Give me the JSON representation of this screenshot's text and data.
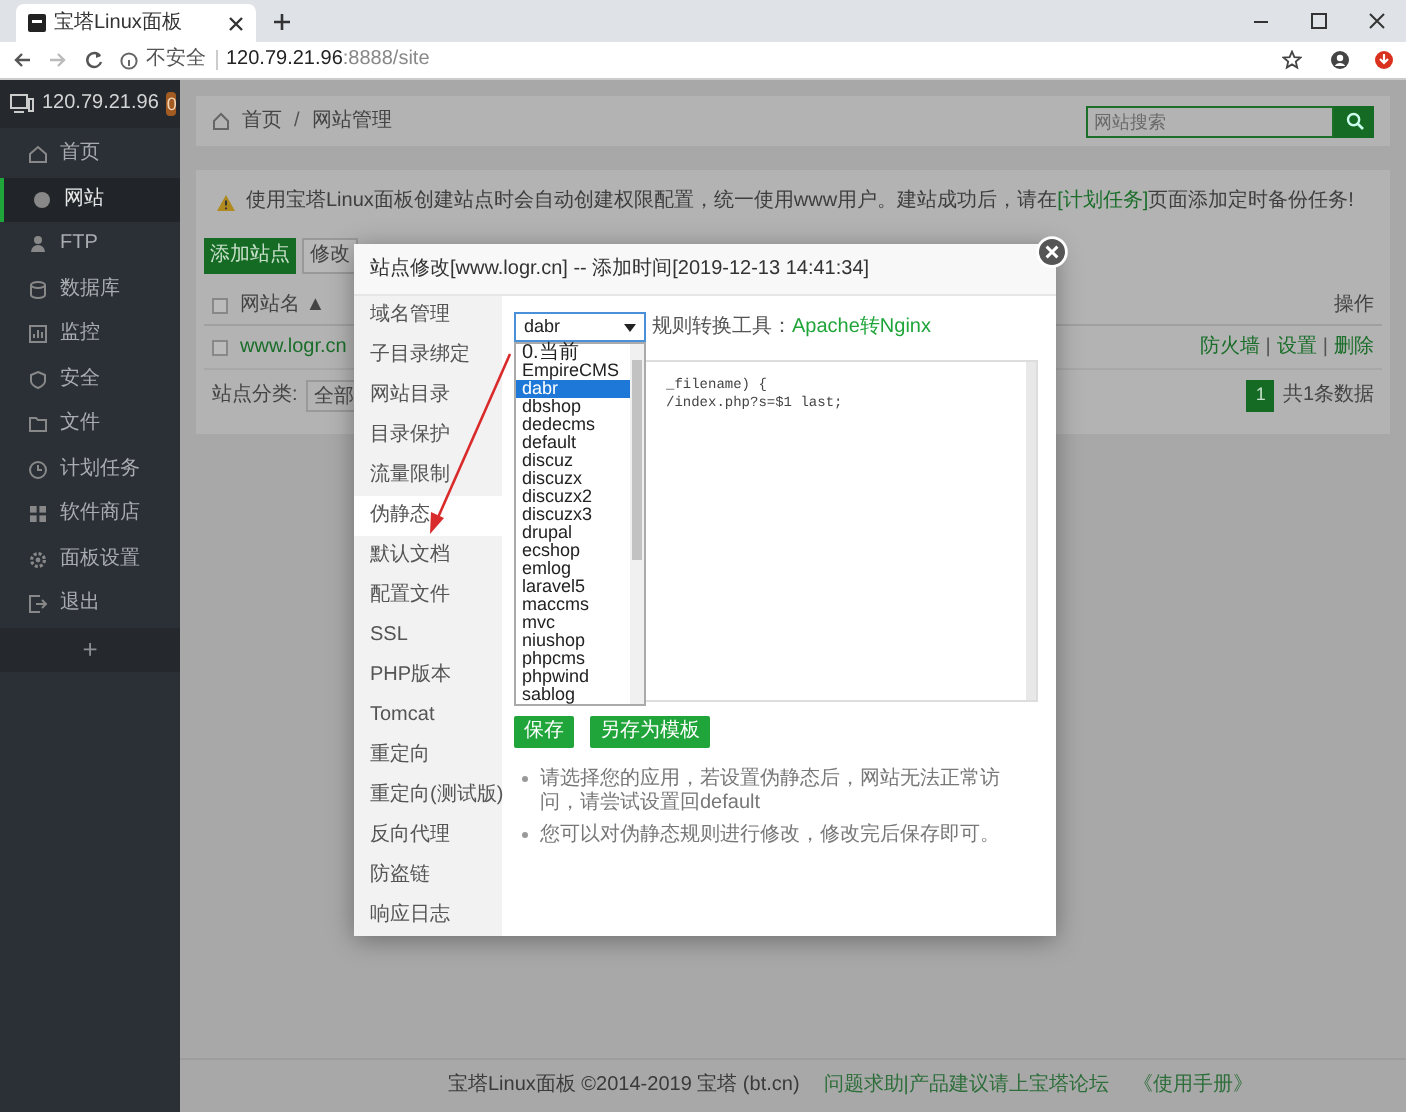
{
  "browser": {
    "tab_title": "宝塔Linux面板",
    "security": "不安全",
    "host": "120.79.21.96",
    "path": ":8888/site"
  },
  "sidebar": {
    "server": "120.79.21.96",
    "badge": "0",
    "add": "+",
    "items": [
      {
        "label": "首页",
        "selected": false
      },
      {
        "label": "网站",
        "selected": true
      },
      {
        "label": "FTP",
        "selected": false
      },
      {
        "label": "数据库",
        "selected": false
      },
      {
        "label": "监控",
        "selected": false
      },
      {
        "label": "安全",
        "selected": false
      },
      {
        "label": "文件",
        "selected": false
      },
      {
        "label": "计划任务",
        "selected": false
      },
      {
        "label": "软件商店",
        "selected": false
      },
      {
        "label": "面板设置",
        "selected": false
      },
      {
        "label": "退出",
        "selected": false
      }
    ]
  },
  "breadcrumb": {
    "home": "首页",
    "separator": "/",
    "current": "网站管理"
  },
  "search": {
    "placeholder": "网站搜索"
  },
  "notice": {
    "before": "使用宝塔Linux面板创建站点时会自动创建权限配置，统一使用www用户。建站成功后，请在",
    "link": "[计划任务]",
    "after": "页面添加定时备份任务!"
  },
  "toolbar": [
    "添加站点",
    "修改"
  ],
  "table": {
    "select_all": {
      "checked": false
    },
    "columns": [
      {
        "label": "网站名",
        "sort": "▲"
      },
      {
        "label": "操作"
      }
    ],
    "rows": [
      {
        "checked": false,
        "name": "www.logr.cn",
        "actions": [
          "防火墙",
          "设置",
          "删除"
        ],
        "separator": "|"
      }
    ]
  },
  "category": {
    "label": "站点分类:",
    "value": "全部"
  },
  "pagination": {
    "page": "1",
    "total": "共1条数据"
  },
  "modal": {
    "title": "站点修改[www.logr.cn] -- 添加时间[2019-12-13 14:41:34]",
    "menu": [
      {
        "label": "域名管理",
        "selected": false
      },
      {
        "label": "子目录绑定",
        "selected": false
      },
      {
        "label": "网站目录",
        "selected": false
      },
      {
        "label": "目录保护",
        "selected": false
      },
      {
        "label": "流量限制",
        "selected": false
      },
      {
        "label": "伪静态",
        "selected": true
      },
      {
        "label": "默认文档",
        "selected": false
      },
      {
        "label": "配置文件",
        "selected": false
      },
      {
        "label": "SSL",
        "selected": false
      },
      {
        "label": "PHP版本",
        "selected": false
      },
      {
        "label": "Tomcat",
        "selected": false
      },
      {
        "label": "重定向",
        "selected": false
      },
      {
        "label": "重定向(测试版)",
        "selected": false
      },
      {
        "label": "反向代理",
        "selected": false
      },
      {
        "label": "防盗链",
        "selected": false
      },
      {
        "label": "响应日志",
        "selected": false
      }
    ],
    "select_value": "dabr",
    "tool_label": "规则转换工具：",
    "tool_link": "Apache转Nginx",
    "options": [
      {
        "label": "0.当前",
        "selected": false
      },
      {
        "label": "EmpireCMS",
        "selected": false
      },
      {
        "label": "dabr",
        "selected": true
      },
      {
        "label": "dbshop",
        "selected": false
      },
      {
        "label": "dedecms",
        "selected": false
      },
      {
        "label": "default",
        "selected": false
      },
      {
        "label": "discuz",
        "selected": false
      },
      {
        "label": "discuzx",
        "selected": false
      },
      {
        "label": "discuzx2",
        "selected": false
      },
      {
        "label": "discuzx3",
        "selected": false
      },
      {
        "label": "drupal",
        "selected": false
      },
      {
        "label": "ecshop",
        "selected": false
      },
      {
        "label": "emlog",
        "selected": false
      },
      {
        "label": "laravel5",
        "selected": false
      },
      {
        "label": "maccms",
        "selected": false
      },
      {
        "label": "mvc",
        "selected": false
      },
      {
        "label": "niushop",
        "selected": false
      },
      {
        "label": "phpcms",
        "selected": false
      },
      {
        "label": "phpwind",
        "selected": false
      },
      {
        "label": "sablog",
        "selected": false
      }
    ],
    "code_lines": [
      "_filename) {",
      "/index.php?s=$1 last;"
    ],
    "buttons": [
      "保存",
      "另存为模板"
    ],
    "notes": [
      "请选择您的应用，若设置伪静态后，网站无法正常访问，请尝试设置回default",
      "您可以对伪静态规则进行修改，修改完后保存即可。"
    ]
  },
  "footer": {
    "copyright": "宝塔Linux面板 ©2014-2019 宝塔 (bt.cn)",
    "forum": "问题求助|产品建议请上宝塔论坛",
    "manual": "《使用手册》"
  }
}
